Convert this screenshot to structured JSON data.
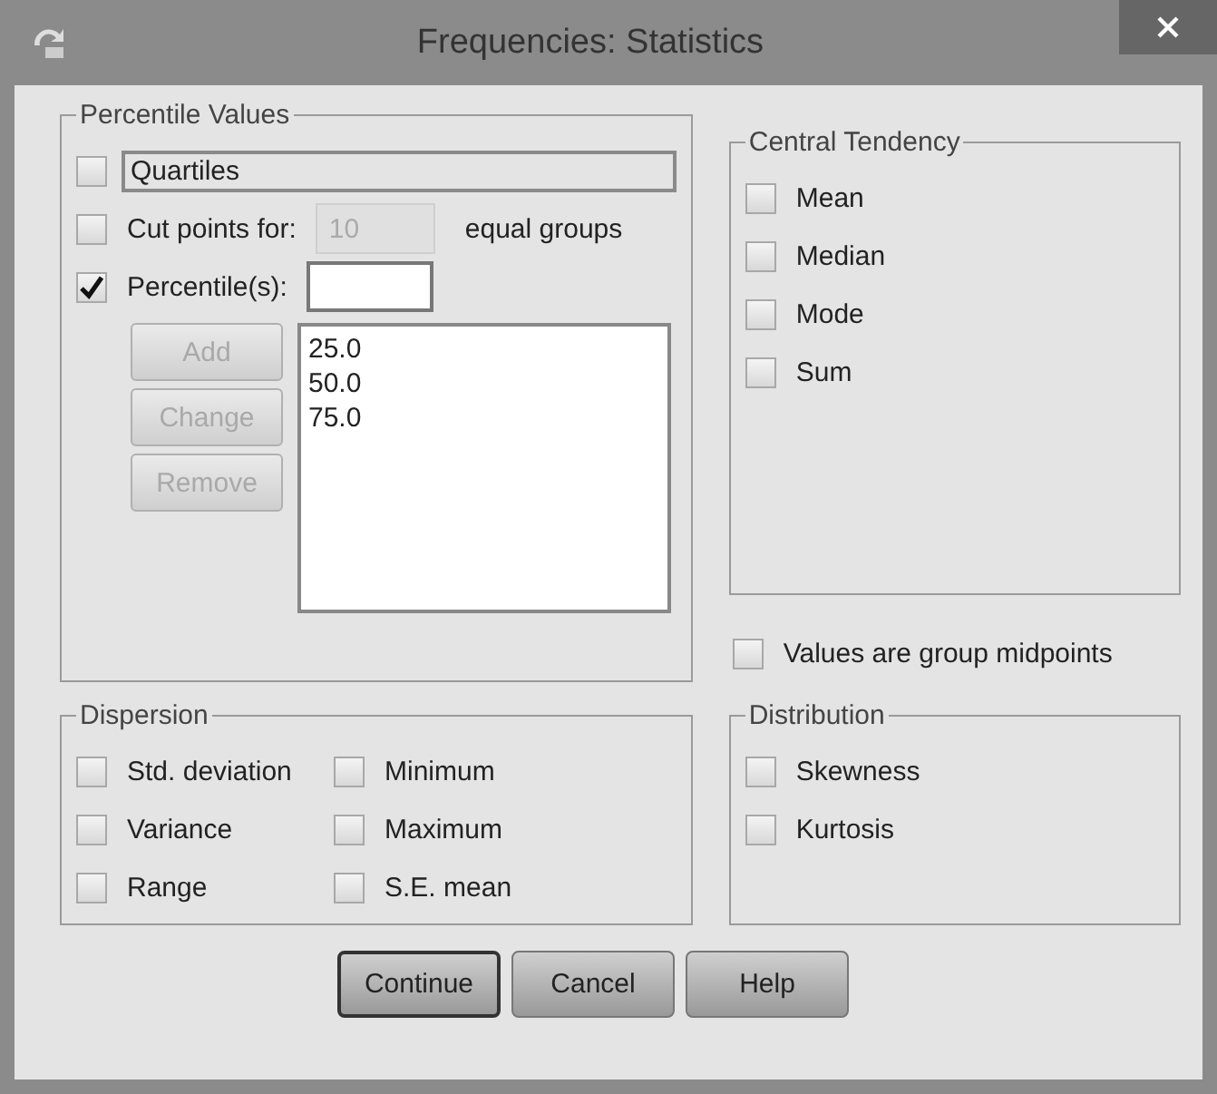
{
  "window": {
    "title": "Frequencies: Statistics"
  },
  "percentile_values": {
    "title": "Percentile Values",
    "rows": [
      {
        "kind": "plain",
        "label": "Quartiles",
        "checked": false,
        "focused": true
      },
      {
        "kind": "cutpoints",
        "label": "Cut points for:",
        "checked": false,
        "focused": false,
        "value": "10",
        "field_disabled": true,
        "suffix": "equal groups"
      },
      {
        "kind": "field",
        "label": "Percentile(s):",
        "checked": true,
        "focused": false,
        "field_disabled": false
      }
    ],
    "buttons": [
      {
        "label": "Add",
        "disabled": true
      },
      {
        "label": "Change",
        "disabled": true
      },
      {
        "label": "Remove",
        "disabled": true
      }
    ],
    "list": [
      "25.0",
      "50.0",
      "75.0"
    ]
  },
  "central_tendency": {
    "title": "Central Tendency",
    "items": [
      {
        "label": "Mean",
        "checked": false
      },
      {
        "label": "Median",
        "checked": false
      },
      {
        "label": "Mode",
        "checked": false
      },
      {
        "label": "Sum",
        "checked": false
      }
    ]
  },
  "group_midpoints": {
    "label": "Values are group midpoints",
    "checked": false
  },
  "dispersion": {
    "title": "Dispersion",
    "items": [
      {
        "label": "Std. deviation",
        "checked": false
      },
      {
        "label": "Variance",
        "checked": false
      },
      {
        "label": "Range",
        "checked": false
      },
      {
        "label": "Minimum",
        "checked": false
      },
      {
        "label": "Maximum",
        "checked": false
      },
      {
        "label": "S.E. mean",
        "checked": false
      }
    ]
  },
  "distribution": {
    "title": "Distribution",
    "items": [
      {
        "label": "Skewness",
        "checked": false
      },
      {
        "label": "Kurtosis",
        "checked": false
      }
    ]
  },
  "buttons": [
    {
      "label": "Continue",
      "default": true
    },
    {
      "label": "Cancel",
      "default": false
    },
    {
      "label": "Help",
      "default": false
    }
  ]
}
